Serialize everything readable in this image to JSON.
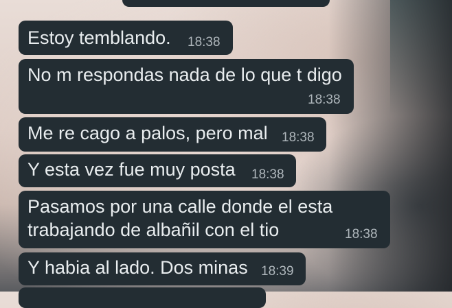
{
  "chat": {
    "messages": [
      {
        "lines": [
          "Estoy temblando."
        ],
        "time": "18:38"
      },
      {
        "lines": [
          "No m respondas nada de lo que t digo"
        ],
        "time": "18:38"
      },
      {
        "lines": [
          "Me re cago a palos, pero mal"
        ],
        "time": "18:38"
      },
      {
        "lines": [
          "Y esta vez fue muy posta"
        ],
        "time": "18:38"
      },
      {
        "lines": [
          "Pasamos por una calle donde el esta",
          "trabajando de albañil con el tio"
        ],
        "time": "18:38"
      },
      {
        "lines": [
          "Y habia al lado. Dos minas"
        ],
        "time": "18:39"
      }
    ]
  },
  "colors": {
    "bubble": "#232d33",
    "text": "#e9edef",
    "timestamp": "#aeb6bb"
  }
}
